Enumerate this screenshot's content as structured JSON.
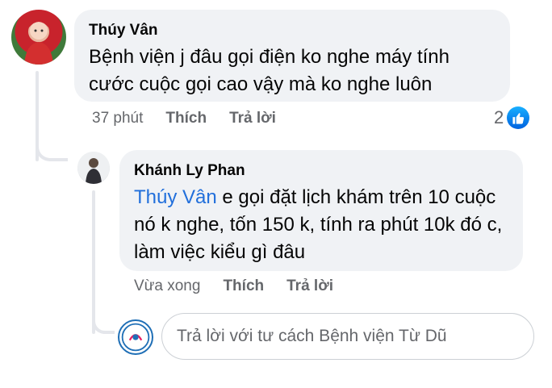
{
  "comments": [
    {
      "author": "Thúy Vân",
      "text": "Bệnh viện j đâu gọi điện ko nghe máy tính cước cuộc gọi cao vậy mà ko nghe luôn",
      "time": "37 phút",
      "like_label": "Thích",
      "reply_label": "Trả lời",
      "reaction_count": "2",
      "reaction_icon": "like-icon"
    }
  ],
  "replies": [
    {
      "author": "Khánh Ly Phan",
      "mention": "Thúy Vân",
      "text": " e gọi  đặt lịch khám trên 10 cuộc nó k nghe, tốn 150 k, tính ra phút 10k đó c, làm việc kiểu gì đâu",
      "time": "Vừa xong",
      "like_label": "Thích",
      "reply_label": "Trả lời"
    }
  ],
  "reply_box": {
    "placeholder": "Trả lời với tư cách Bệnh viện Từ Dũ"
  },
  "colors": {
    "mention": "#216fdb",
    "bubble": "#f0f2f5",
    "secondary_text": "#65676b",
    "like_blue": "#0062df"
  }
}
